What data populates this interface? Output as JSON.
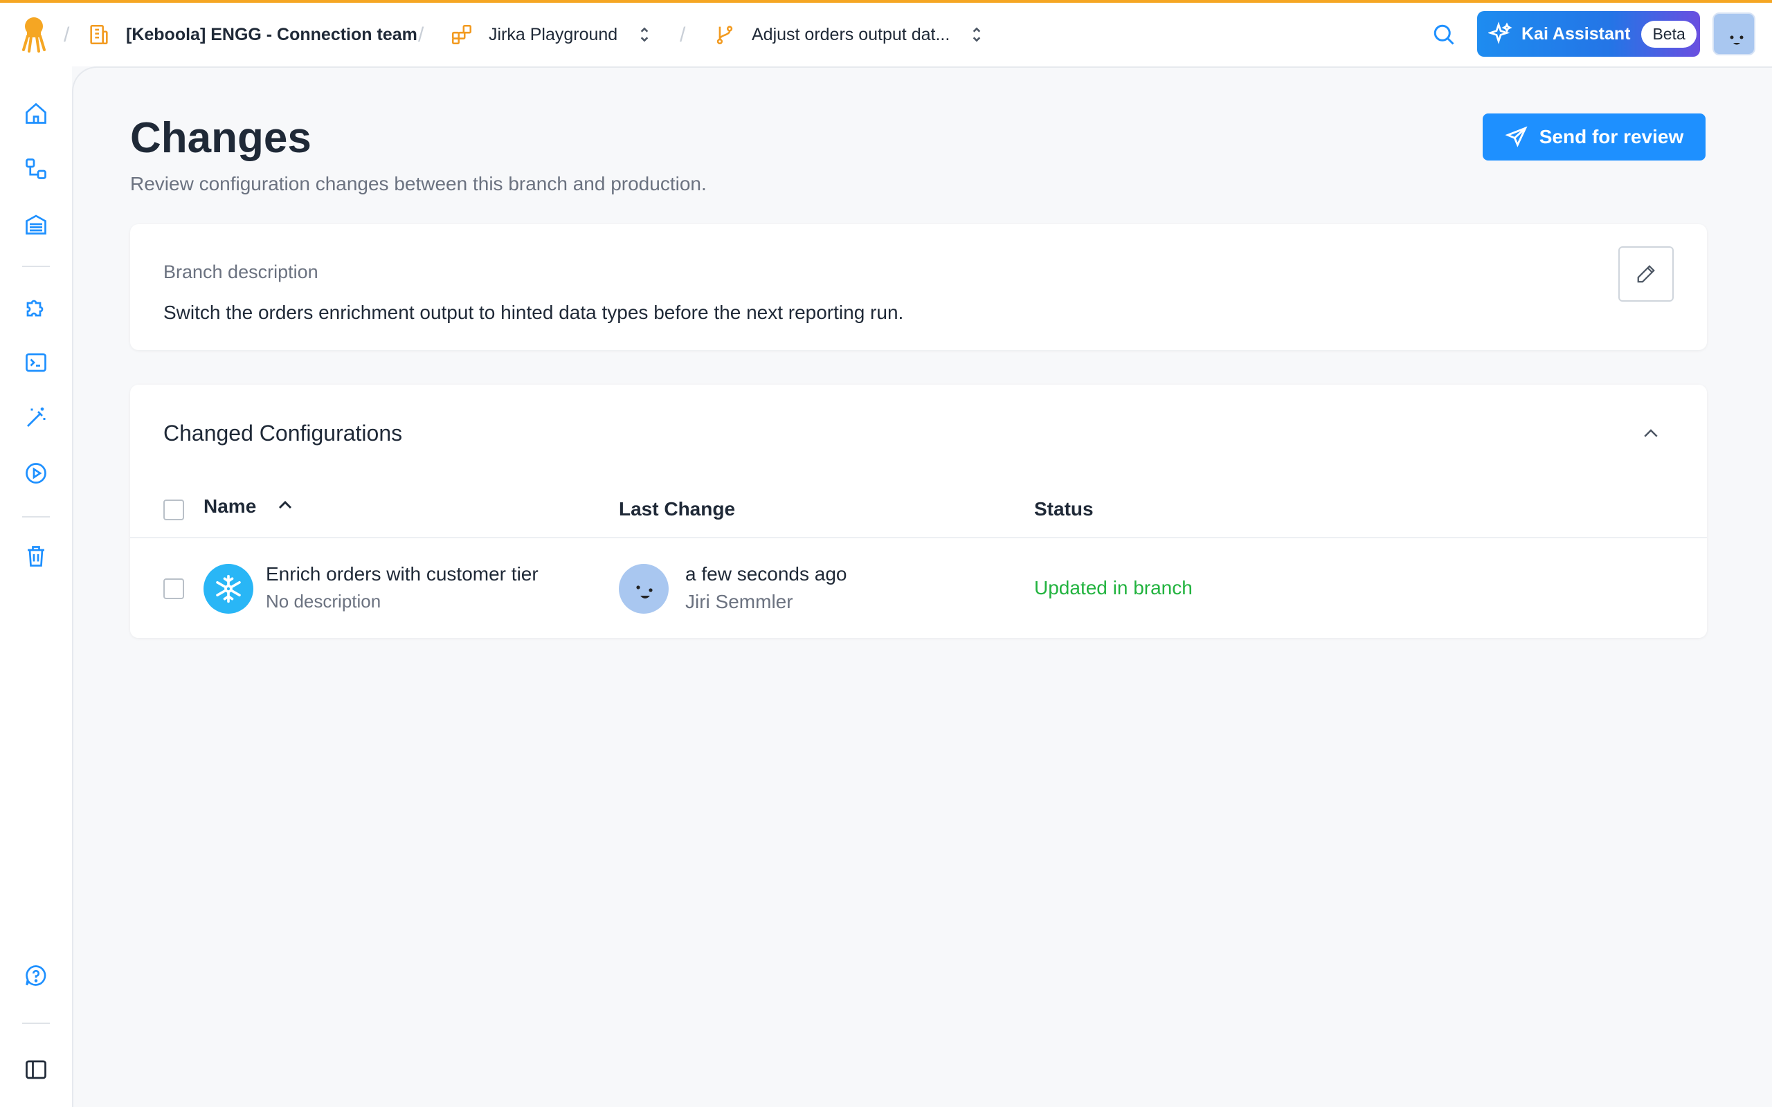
{
  "breadcrumb": {
    "organization": "[Keboola] ENGG - Connection team",
    "project": "Jirka Playground",
    "branch": "Adjust orders output dat..."
  },
  "assistant": {
    "label": "Kai Assistant",
    "badge": "Beta"
  },
  "page": {
    "title": "Changes",
    "subtitle": "Review configuration changes between this branch and production.",
    "send_button": "Send for review"
  },
  "branch_description": {
    "label": "Branch description",
    "text": "Switch the orders enrichment output to hinted data types before the next reporting run."
  },
  "changed_configurations": {
    "title": "Changed Configurations",
    "columns": {
      "name": "Name",
      "last_change": "Last Change",
      "status": "Status"
    },
    "rows": [
      {
        "name": "Enrich orders with customer tier",
        "description": "No description",
        "component_icon": "snowflake-icon",
        "last_change_time": "a few seconds ago",
        "last_change_user": "Jiri Semmler",
        "status": "Updated in branch"
      }
    ]
  },
  "colors": {
    "accent": "#1e90ff",
    "brand_orange": "#f5a623",
    "status_green": "#22b33f"
  }
}
